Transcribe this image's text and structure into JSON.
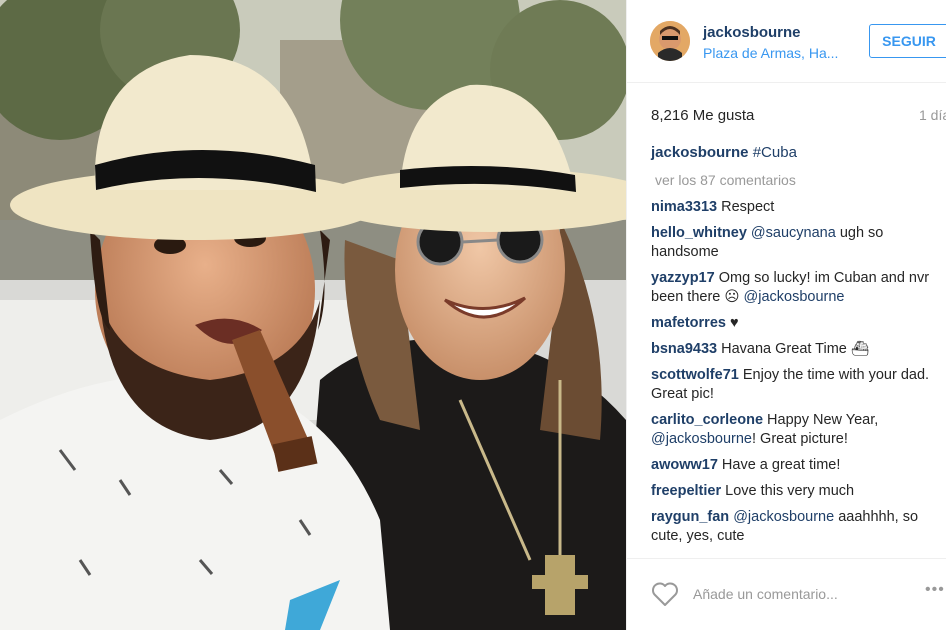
{
  "post": {
    "username": "jackosbourne",
    "location": "Plaza de Armas, Ha...",
    "follow_label": "SEGUIR",
    "likes": "8,216 Me gusta",
    "time_ago": "1 día",
    "caption_user": "jackosbourne",
    "caption_text": "#Cuba",
    "view_all": "ver los 87 comentarios",
    "add_comment_placeholder": "Añade un comentario...",
    "more_label": "•••"
  },
  "comments": [
    {
      "user": "nima3313",
      "text": "Respect"
    },
    {
      "user": "hello_whitney",
      "mention": "@saucynana",
      "text": "ugh so handsome"
    },
    {
      "user": "yazzyp17",
      "text": "Omg so lucky! im Cuban and nvr been there ☹",
      "mention_after": "@jackosbourne"
    },
    {
      "user": "mafetorres",
      "text": "♥"
    },
    {
      "user": "bsna9433",
      "text": "Havana Great Time ⛴"
    },
    {
      "user": "scottwolfe71",
      "text": "Enjoy the time with your dad. Great pic!"
    },
    {
      "user": "carlito_corleone",
      "text": "Happy New Year,",
      "mention_after": "@jackosbourne",
      "text_after": "! Great picture!"
    },
    {
      "user": "awoww17",
      "text": "Have a great time!"
    },
    {
      "user": "freepeltier",
      "text": "Love this very much"
    },
    {
      "user": "raygun_fan",
      "mention": "@jackosbourne",
      "text": "aaahhhh, so cute, yes, cute"
    }
  ],
  "icons": {
    "heart": "heart-icon",
    "more": "more-options-icon",
    "avatar": "avatar"
  },
  "colors": {
    "link": "#1f3f68",
    "accent": "#3897f0",
    "muted": "#999999",
    "text": "#262626"
  }
}
